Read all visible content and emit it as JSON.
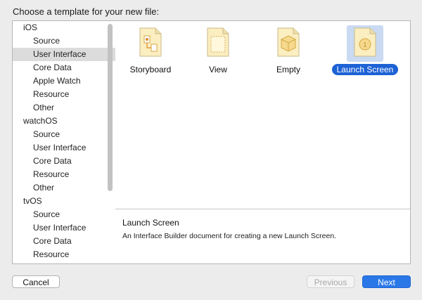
{
  "dialog": {
    "title": "Choose a template for your new file:"
  },
  "sidebar": {
    "groups": [
      {
        "header": "iOS",
        "items": [
          "Source",
          "User Interface",
          "Core Data",
          "Apple Watch",
          "Resource",
          "Other"
        ]
      },
      {
        "header": "watchOS",
        "items": [
          "Source",
          "User Interface",
          "Core Data",
          "Resource",
          "Other"
        ]
      },
      {
        "header": "tvOS",
        "items": [
          "Source",
          "User Interface",
          "Core Data",
          "Resource"
        ]
      }
    ],
    "selected": "iOS / User Interface"
  },
  "templates": [
    {
      "label": "Storyboard",
      "icon": "storyboard-icon"
    },
    {
      "label": "View",
      "icon": "view-icon"
    },
    {
      "label": "Empty",
      "icon": "empty-icon"
    },
    {
      "label": "Launch Screen",
      "icon": "launch-screen-icon",
      "selected": true
    }
  ],
  "description": {
    "title": "Launch Screen",
    "text": "An Interface Builder document for creating a new Launch Screen."
  },
  "buttons": {
    "cancel": "Cancel",
    "previous": "Previous",
    "next": "Next"
  },
  "colors": {
    "accent": "#1d62d5",
    "next_button": "#2a78e8",
    "selected_row": "#dcdcdc",
    "icon_fill": "#fbeec0"
  }
}
